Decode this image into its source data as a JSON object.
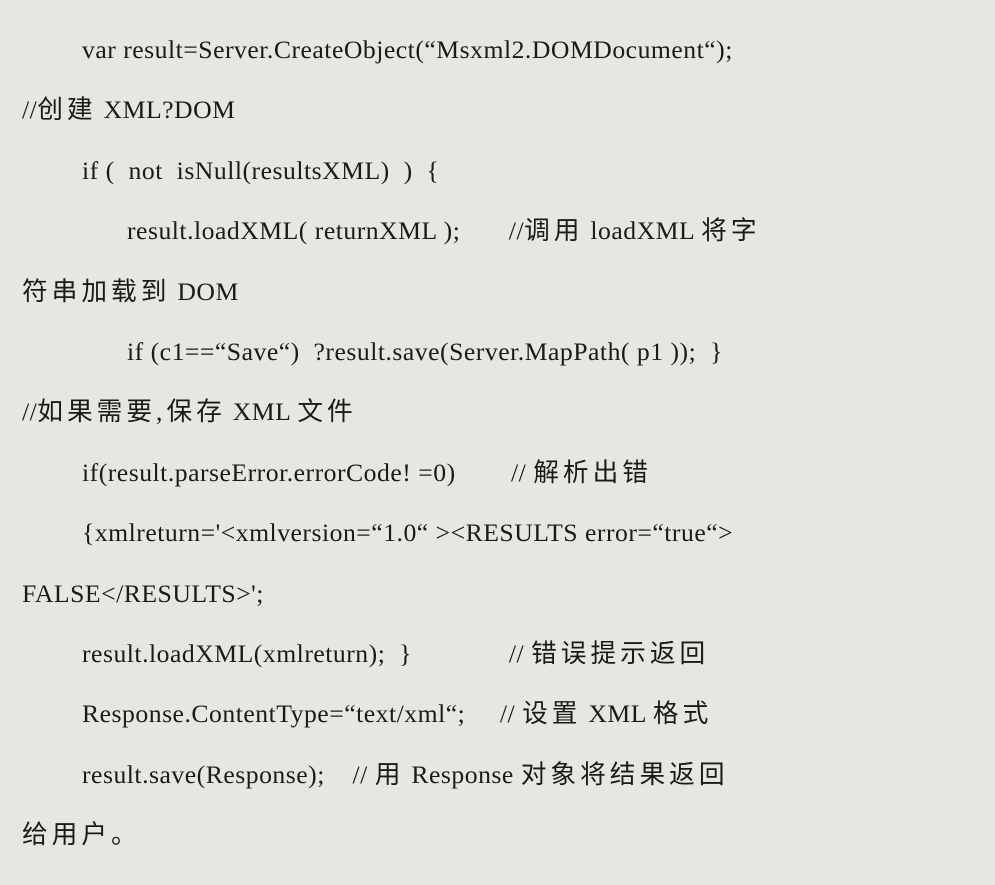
{
  "lines": {
    "l1": "var result=Server.CreateObject(“Msxml2.DOMDocument“);",
    "l2_a": "//",
    "l2_b": "创建",
    "l2_c": " XML?DOM",
    "l3": "if (  not  isNull(resultsXML)  )  {",
    "l4_a": "result.loadXML( returnXML );       //",
    "l4_b": "调用",
    "l4_c": " loadXML ",
    "l4_d": "将字",
    "l5_a": "符串加载到",
    "l5_b": " DOM",
    "l6": "if (c1==“Save“)  ?result.save(Server.MapPath( p1 ));  }",
    "l7_a": "//",
    "l7_b": "如果需要,保存",
    "l7_c": " XML ",
    "l7_d": "文件",
    "l8_a": "if(result.parseError.errorCode! =0)        // ",
    "l8_b": "解析出错",
    "l9": "{xmlreturn='<xmlversion=“1.0“ ><RESULTS error=“true“>",
    "l10": "FALSE</RESULTS>';",
    "l11_a": "result.loadXML(xmlreturn);  }              // ",
    "l11_b": "错误提示返回",
    "l12_a": "Response.ContentType=“text/xml“;     // ",
    "l12_b": "设置",
    "l12_c": " XML ",
    "l12_d": "格式",
    "l13_a": "result.save(Response);    // ",
    "l13_b": "用",
    "l13_c": " Response ",
    "l13_d": "对象将结果返回",
    "l14": "给用户。"
  }
}
